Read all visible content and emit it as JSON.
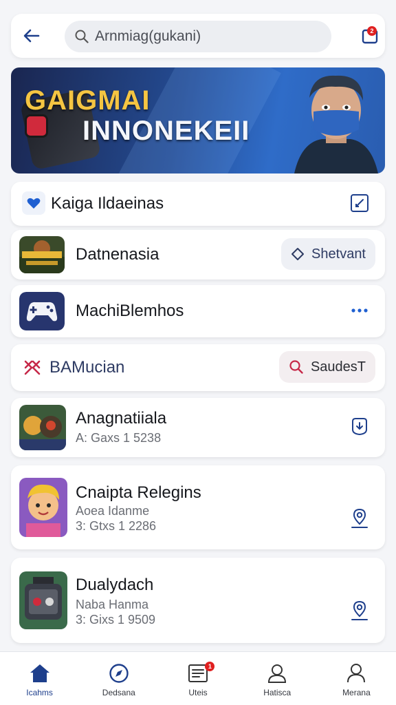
{
  "header": {
    "search_placeholder": "Arnmiag(gukani)",
    "notification_count": "2"
  },
  "banner": {
    "title": "GAIGMAI",
    "subtitle": "INNONEKEII"
  },
  "section_header": {
    "label": "Kaiga Ildaeinas"
  },
  "list": [
    {
      "title": "Datnenasia",
      "action_label": "Shetvant"
    },
    {
      "title": "MachiBlemhos"
    }
  ],
  "section_header_2": {
    "label": "BAMucian",
    "action_label": "SaudesT"
  },
  "games": [
    {
      "title": "Anagnatiiala",
      "meta1": "A: Gaxs 1 5238"
    },
    {
      "title": "Cnaipta Relegins",
      "meta1": "Aoea Idanme",
      "meta2": "3: Gtxs 1 2286"
    },
    {
      "title": "Dualydach",
      "meta1": "Naba Hanma",
      "meta2": "3: Gixs 1 9509"
    }
  ],
  "bottom_nav": {
    "items": [
      {
        "label": "Icahms",
        "icon": "home-icon"
      },
      {
        "label": "Dedsana",
        "icon": "compass-icon"
      },
      {
        "label": "Uteis",
        "icon": "list-icon",
        "badge": "1"
      },
      {
        "label": "Hatisca",
        "icon": "user-icon"
      },
      {
        "label": "Merana",
        "icon": "profile-icon"
      }
    ]
  },
  "colors": {
    "accent": "#1e3f8c",
    "badge": "#e02020",
    "banner_title": "#f5c542"
  }
}
